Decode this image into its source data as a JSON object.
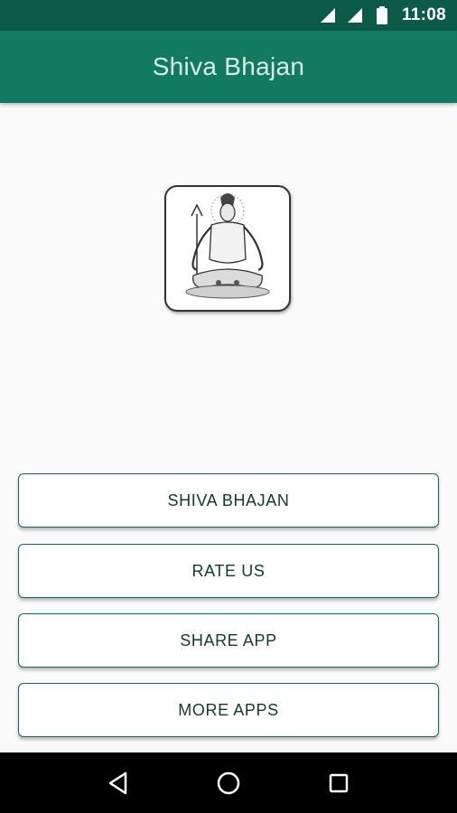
{
  "status_bar": {
    "time": "11:08",
    "icons": [
      "signal-icon",
      "wifi-signal-icon",
      "battery-icon"
    ]
  },
  "app_bar": {
    "title": "Shiva Bhajan"
  },
  "logo": {
    "icon": "shiva-image"
  },
  "menu": {
    "buttons": [
      {
        "label": "SHIVA BHAJAN"
      },
      {
        "label": "RATE US"
      },
      {
        "label": "SHARE APP"
      },
      {
        "label": "MORE APPS"
      }
    ]
  },
  "nav_bar": {
    "icons": [
      "back-icon",
      "home-icon",
      "recents-icon"
    ]
  },
  "colors": {
    "status_bar": "#0b5b46",
    "app_bar": "#127a60",
    "button_border": "#0e6b53",
    "button_text": "#0e3b30",
    "background": "#fafafa"
  }
}
